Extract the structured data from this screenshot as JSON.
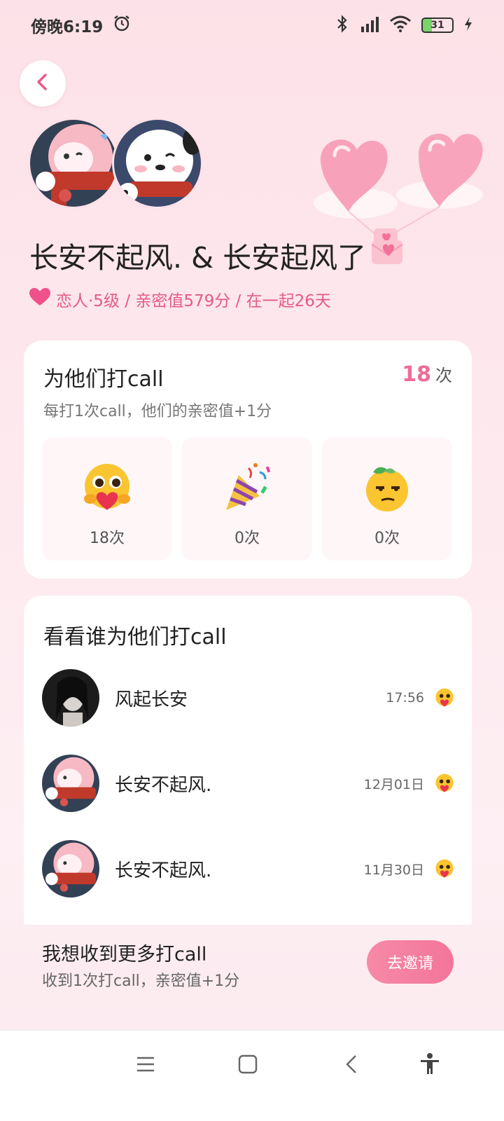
{
  "status_bar": {
    "time": "傍晚6:19",
    "battery": "31"
  },
  "header": {
    "title": "长安不起风. & 长安起风了",
    "relation": "恋人·5级 / 亲密值579分 / 在一起26天"
  },
  "call_card": {
    "title": "为他们打call",
    "count": "18",
    "count_unit": "次",
    "description": "每打1次call，他们的亲密值+1分",
    "reactions": [
      {
        "icon": "hug-face-emoji",
        "label": "18次"
      },
      {
        "icon": "party-popper-emoji",
        "label": "0次"
      },
      {
        "icon": "lemon-face-emoji",
        "label": "0次"
      }
    ]
  },
  "list_card": {
    "title": "看看谁为他们打call",
    "rows": [
      {
        "name": "风起长安",
        "time": "17:56"
      },
      {
        "name": "长安不起风.",
        "time": "12月01日"
      },
      {
        "name": "长安不起风.",
        "time": "11月30日"
      }
    ]
  },
  "invite": {
    "title": "我想收到更多打call",
    "subtitle": "收到1次打call，亲密值+1分",
    "button": "去邀请"
  },
  "colors": {
    "accent": "#ee6d96",
    "button": "#f3759a",
    "background": "#fde1e8"
  }
}
